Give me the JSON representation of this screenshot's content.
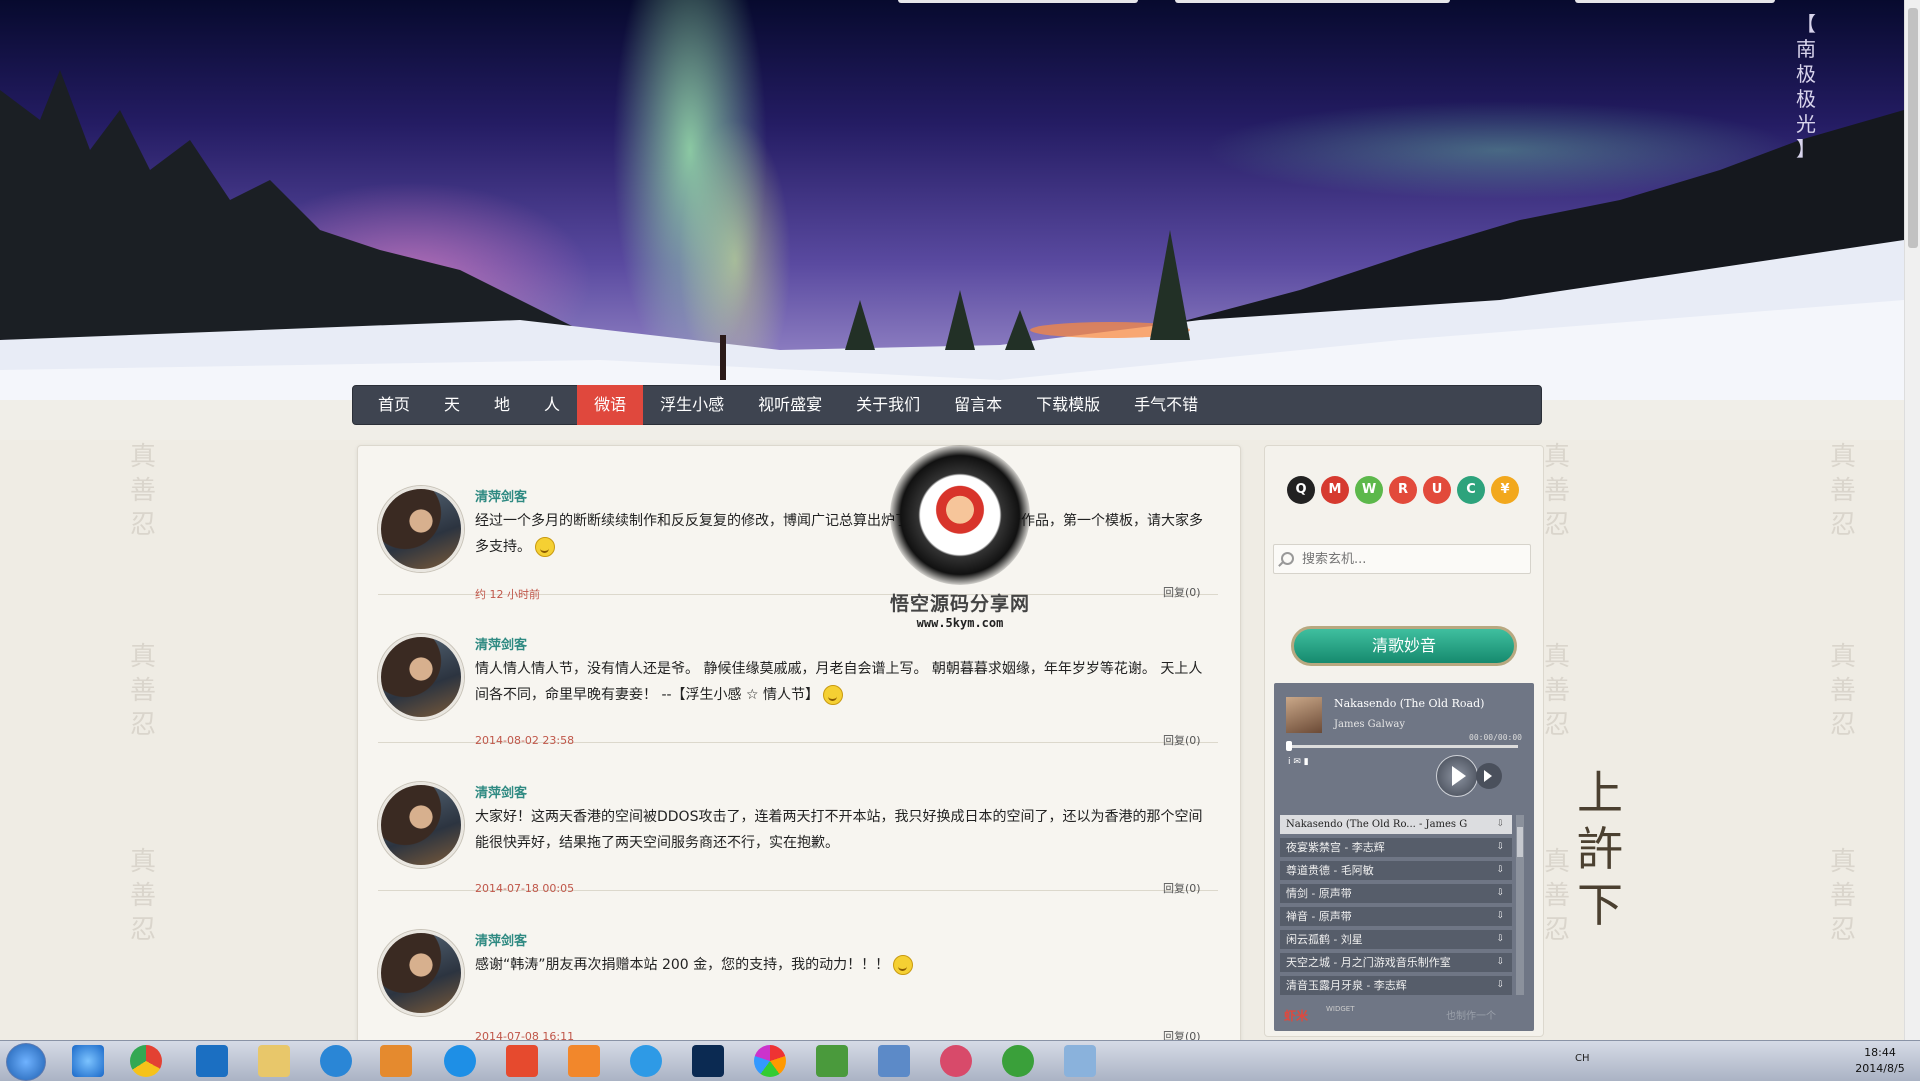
{
  "hero": {
    "vertical_title": [
      "【",
      "南",
      "极",
      "极",
      "光",
      "】"
    ]
  },
  "side_deco": {
    "left_chars": [
      "真",
      "善",
      "忍"
    ],
    "right_big": [
      "上",
      "許",
      "下"
    ]
  },
  "nav": {
    "items": [
      "首页",
      "天",
      "地",
      "人",
      "微语",
      "浮生小感",
      "视听盛宴",
      "关于我们",
      "留言本",
      "下载模版",
      "手气不错"
    ],
    "active_index": 4,
    "active_color": "#e0483d"
  },
  "posts": [
    {
      "author": "清萍剑客",
      "content": "经过一个多月的断断续续制作和反反复复的修改，博闻广记总算出炉了，这是自己第一个作品，第一个模板，请大家多多支持。",
      "time": "约 12 小时前",
      "reply": "回复(0)"
    },
    {
      "author": "清萍剑客",
      "content": "情人情人情人节，没有情人还是爷。 静候佳缘莫戚戚，月老自会谱上写。 朝朝暮暮求姻缘，年年岁岁等花谢。 天上人间各不同，命里早晚有妻妾！ --【浮生小感 ☆ 情人节】",
      "time": "2014-08-02 23:58",
      "reply": "回复(0)"
    },
    {
      "author": "清萍剑客",
      "content": "大家好！这两天香港的空间被DDOS攻击了，连着两天打不开本站，我只好换成日本的空间了，还以为香港的那个空间能很快弄好，结果拖了两天空间服务商还不行，实在抱歉。",
      "time": "2014-07-18 00:05",
      "reply": "回复(0)"
    },
    {
      "author": "清萍剑客",
      "content": "感谢“韩涛”朋友再次捐赠本站 200 金，您的支持，我的动力！！！",
      "time": "2014-07-08 16:11",
      "reply": "回复(0)"
    }
  ],
  "watermark": {
    "title": "悟空源码分享网",
    "url": "www.5kym.com"
  },
  "sidebar": {
    "social_icons": [
      {
        "name": "qq-icon",
        "color": "#222222",
        "glyph": "Q"
      },
      {
        "name": "gmail-icon",
        "color": "#d63a2f",
        "glyph": "M"
      },
      {
        "name": "wechat-icon",
        "color": "#5cb84b",
        "glyph": "W"
      },
      {
        "name": "rss-icon",
        "color": "#e24a3b",
        "glyph": "R"
      },
      {
        "name": "user-icon",
        "color": "#e24a3b",
        "glyph": "U"
      },
      {
        "name": "chat-icon",
        "color": "#2da37c",
        "glyph": "C"
      },
      {
        "name": "donate-icon",
        "color": "#f2a81d",
        "glyph": "¥"
      }
    ],
    "search_placeholder": "搜索玄机...",
    "music_title": "清歌妙音",
    "player": {
      "track_title": "Nakasendo (The Old Road)",
      "track_artist": "James Galway",
      "track_time": "00:00/00:00",
      "progress": 0,
      "playlist": [
        "Nakasendo (The Old Ro... - James G",
        "夜宴紫禁宫 - 李志辉",
        "尊道贵德 - 毛阿敏",
        "情剑 - 原声带",
        "禅音 - 原声带",
        "闲云孤鹤 - 刘星",
        "天空之城 - 月之门游戏音乐制作室",
        "清音玉露月牙泉 - 李志辉"
      ],
      "footer_brand": "虾米",
      "footer_widget": "WIDGET",
      "footer_make": "也制作一个"
    }
  },
  "taskbar": {
    "tray_lang": "CH",
    "time": "18:44",
    "date": "2014/8/5"
  }
}
